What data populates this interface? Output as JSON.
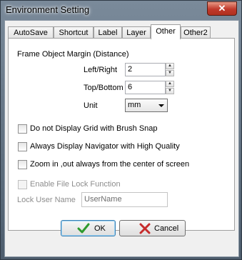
{
  "window": {
    "title": "Environment Setting",
    "close_label": "✕"
  },
  "tabs": [
    {
      "label": "AutoSave"
    },
    {
      "label": "Shortcut"
    },
    {
      "label": "Label"
    },
    {
      "label": "Layer"
    },
    {
      "label": "Other",
      "active": true
    },
    {
      "label": "Other2"
    }
  ],
  "margin": {
    "heading": "Frame Object Margin (Distance)",
    "left_right_label": "Left/Right",
    "left_right_value": "2",
    "top_bottom_label": "Top/Bottom",
    "top_bottom_value": "6",
    "unit_label": "Unit",
    "unit_value": "mm"
  },
  "options": {
    "no_grid": "Do not Display Grid with Brush Snap",
    "navigator": "Always Display Navigator with High Quality",
    "zoom_center": "Zoom in ,out always from the center of screen"
  },
  "file_lock": {
    "enable_label": "Enable File Lock Function",
    "user_label": "Lock User Name",
    "user_value": "UserName"
  },
  "buttons": {
    "ok": "OK",
    "cancel": "Cancel"
  },
  "colors": {
    "ok_check": "#2e9a2e",
    "cancel_x": "#c62b2b",
    "close_button": "#c0392b"
  }
}
